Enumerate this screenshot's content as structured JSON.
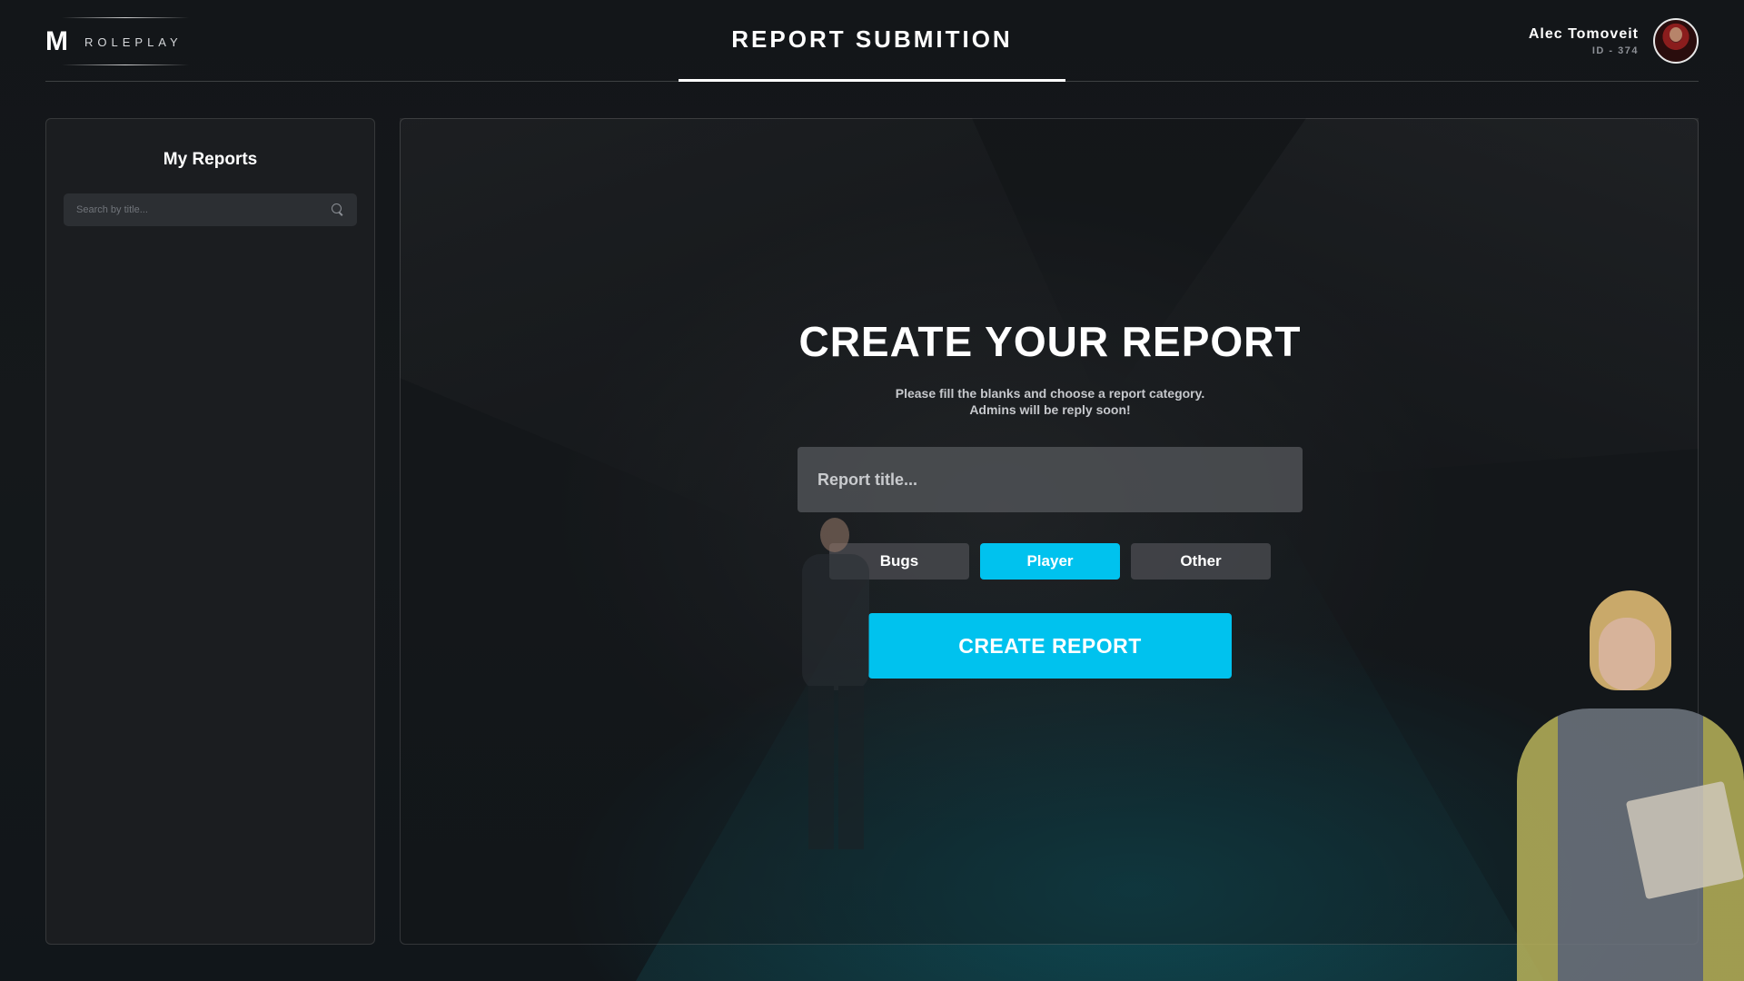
{
  "header": {
    "logo_mark": "M",
    "logo_text": "ROLEPLAY",
    "title": "REPORT SUBMITION",
    "user": {
      "name": "Alec Tomoveit",
      "id": "ID - 374"
    }
  },
  "sidebar": {
    "title": "My Reports",
    "search": {
      "placeholder": "Search by title..."
    }
  },
  "main": {
    "heading": "CREATE YOUR REPORT",
    "subtitle_line1": "Please fill the blanks and choose a report category.",
    "subtitle_line2": "Admins will be reply soon!",
    "title_input": {
      "placeholder": "Report title...",
      "value": ""
    },
    "categories": [
      {
        "label": "Bugs",
        "selected": false
      },
      {
        "label": "Player",
        "selected": true
      },
      {
        "label": "Other",
        "selected": false
      }
    ],
    "create_button": "CREATE REPORT"
  },
  "colors": {
    "accent": "#00c2ee",
    "background": "#0f1114"
  }
}
